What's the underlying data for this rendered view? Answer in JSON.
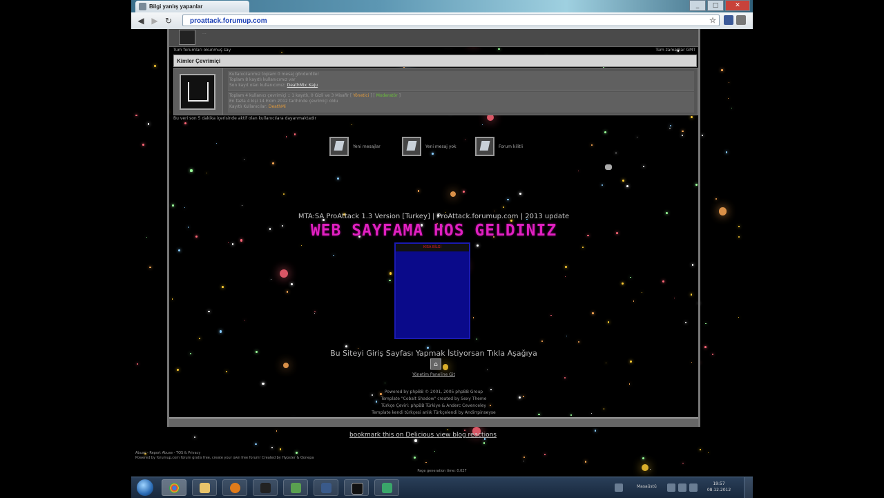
{
  "browser": {
    "tab_title": "Bilgi yanlış yapanlar",
    "url": "proattack.forumup.com",
    "star": "☆"
  },
  "forum": {
    "top_text": "...",
    "timezone_left": "Tüm forumları okunmuş say",
    "timezone_right": "Tüm zamanlar GMT",
    "who_online_title": "Kimler Çevrimiçi",
    "online_lines": [
      "Kullanıcılarımız toplam 0 mesaj gönderdiler",
      "Toplam 8 kayıtlı kullanıcımız var",
      "Son kayıt olan kullanıcımız:"
    ],
    "last_member": "DeathMix_Kaju",
    "online_detail_lines": [
      "Toplam 4 kullanıcı çevrimiçi :: 1 kayıtlı, 0 Gizli ve 3 Misafir",
      "En fazla 4 kişi 14 Ekim 2012 tarihinde çevrimiçi oldu",
      "Kayıtlı Kullanıcılar:"
    ],
    "online_admin": "Yönetici",
    "online_mod": "Moderatör",
    "online_user": "DeathMi",
    "active_note": "Bu veri son 5 dakika içerisinde aktif olan kullanıcılara dayanmaktadır",
    "legend": [
      {
        "label": "Yeni mesajlar"
      },
      {
        "label": "Yeni mesaj yok"
      },
      {
        "label": "Forum kilitli"
      }
    ]
  },
  "banner": {
    "mta_line": "MTA:SA ProAttack 1.3 Version [Turkey] | ProAttack.forumup.com | 2013 update",
    "welcome": "WEB SAYFAMA HOS GELDINIZ",
    "blue_box_header": "KISA BİLGİ",
    "homepage_text": "Bu Siteyi Giriş Sayfası Yapmak İstiyorsan Tıkla Aşağıya",
    "forum_admin": "Yönetim Paneline Git",
    "credits": [
      "Powered by phpBB © 2001, 2005 phpBB Group",
      "Template \"Cobalt Shadow\" created by Sexy Theme",
      "Türkçe Çeviri: phpBB Türkiye & Anderc Cevenceley",
      "Template kendi türkçesi anlık Türkçelendi by Andirrpinseyse"
    ],
    "bookmark": "bookmark this on Delicious",
    "view_blog": "view blog reactions",
    "footer_links": [
      "Abuse - Report Abuse - TOS & Privacy",
      "Powered by forumup.com forum gratis free, create your own free forum! Created by Hypster & Qonepa"
    ],
    "gen_time": "Page generation time: 0.027"
  },
  "taskbar": {
    "language": "Masaüstü",
    "time": "19:57",
    "date": "08.12.2012"
  },
  "colors": {
    "welcome": "#e020c0",
    "url": "#1a3fb5",
    "blue_box": "#0a0a8a"
  }
}
